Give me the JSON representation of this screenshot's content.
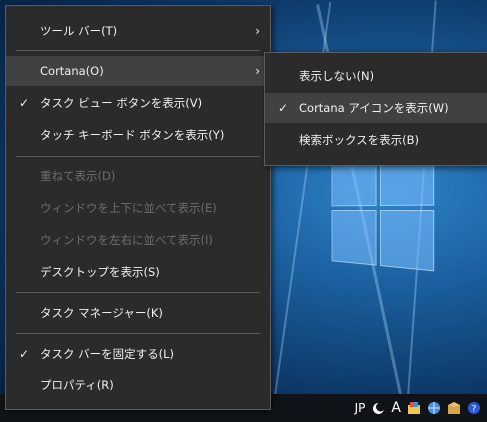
{
  "main_menu": {
    "items": [
      {
        "label": "ツール バー(T)",
        "state": "enabled",
        "checked": false,
        "submenu": true
      },
      {
        "label": "Cortana(O)",
        "state": "highlighted",
        "checked": false,
        "submenu": true
      },
      {
        "label": "タスク ビュー ボタンを表示(V)",
        "state": "enabled",
        "checked": true,
        "submenu": false
      },
      {
        "label": "タッチ キーボード ボタンを表示(Y)",
        "state": "enabled",
        "checked": false,
        "submenu": false
      },
      {
        "label": "重ねて表示(D)",
        "state": "disabled",
        "checked": false,
        "submenu": false
      },
      {
        "label": "ウィンドウを上下に並べて表示(E)",
        "state": "disabled",
        "checked": false,
        "submenu": false
      },
      {
        "label": "ウィンドウを左右に並べて表示(I)",
        "state": "disabled",
        "checked": false,
        "submenu": false
      },
      {
        "label": "デスクトップを表示(S)",
        "state": "enabled",
        "checked": false,
        "submenu": false
      },
      {
        "label": "タスク マネージャー(K)",
        "state": "enabled",
        "checked": false,
        "submenu": false
      },
      {
        "label": "タスク バーを固定する(L)",
        "state": "enabled",
        "checked": true,
        "submenu": false
      },
      {
        "label": "プロパティ(R)",
        "state": "enabled",
        "checked": false,
        "submenu": false
      }
    ],
    "check_glyph": "✓",
    "arrow_glyph": "›"
  },
  "cortana_submenu": {
    "items": [
      {
        "label": "表示しない(N)",
        "checked": false
      },
      {
        "label": "Cortana アイコンを表示(W)",
        "checked": true,
        "highlighted": true
      },
      {
        "label": "検索ボックスを表示(B)",
        "checked": false
      }
    ]
  },
  "taskbar": {
    "tray": {
      "ime_text": "JP",
      "ime_mode_text": "A",
      "icons": [
        "moon-icon",
        "color-picker-icon",
        "network-globe-icon",
        "package-icon",
        "help-icon"
      ]
    }
  },
  "colors": {
    "menu_bg": "#2b2b2b",
    "menu_highlight": "#414141",
    "menu_text": "#f0f0f0",
    "menu_disabled_text": "#6d6d6d",
    "separator": "#5a5a5a",
    "taskbar_bg": "#101418"
  }
}
